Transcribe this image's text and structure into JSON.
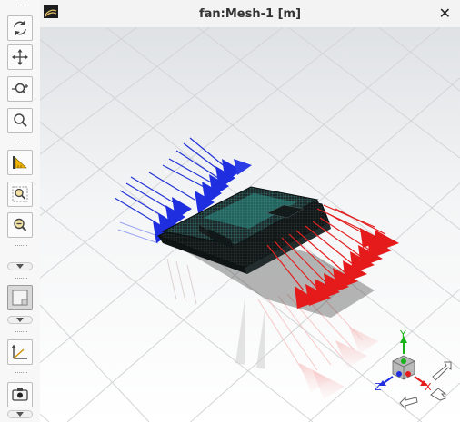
{
  "window": {
    "title": "fan:Mesh-1 [m]",
    "close_label": "✕"
  },
  "toolbar": {
    "tools": [
      {
        "name": "rotate",
        "icon": "rotate-icon"
      },
      {
        "name": "pan",
        "icon": "pan-icon"
      },
      {
        "name": "zoom",
        "icon": "zoom-icon"
      },
      {
        "name": "zoom-to-fit",
        "icon": "zoom-fit-icon"
      },
      {
        "name": "probe",
        "icon": "probe-icon"
      },
      {
        "name": "zoom-box",
        "icon": "zoom-box-icon"
      },
      {
        "name": "zoom-out",
        "icon": "zoom-out-icon"
      },
      {
        "name": "view",
        "icon": "view-icon",
        "active": true
      },
      {
        "name": "axes",
        "icon": "axes-icon"
      },
      {
        "name": "screenshot",
        "icon": "camera-icon"
      }
    ]
  },
  "axis_triad": {
    "x_label": "X",
    "y_label": "Y",
    "z_label": "Z"
  },
  "colors": {
    "inlet_vectors": "#1f2fe0",
    "outlet_vectors": "#e51a1a",
    "mesh_body": "#1a2a2a",
    "mesh_face": "#2f8f86",
    "floor_grid": "#dcdcdc"
  }
}
